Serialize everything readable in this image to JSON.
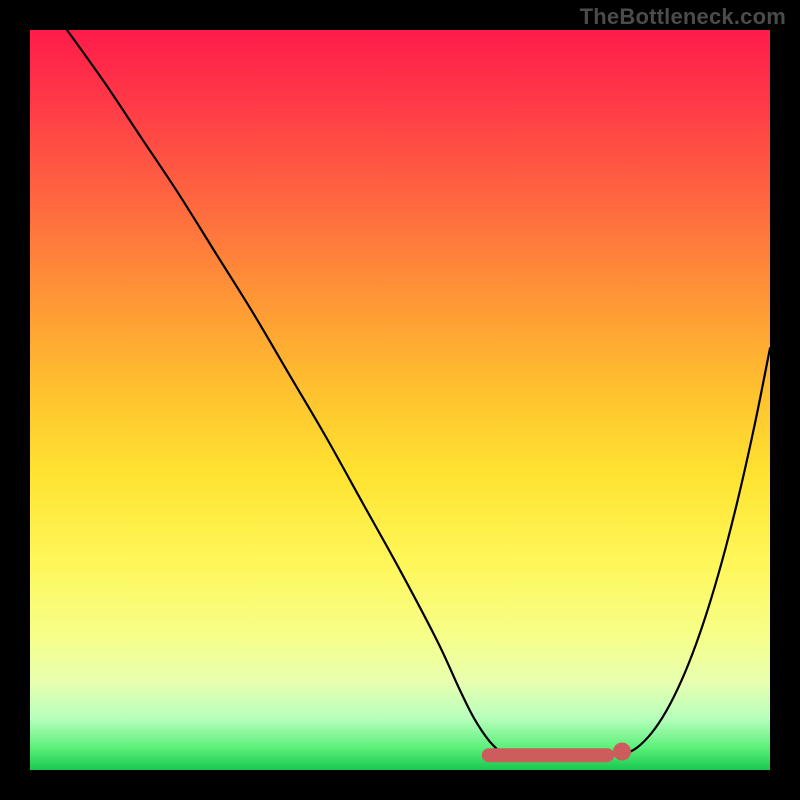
{
  "watermark": "TheBottleneck.com",
  "colors": {
    "background": "#000000",
    "gradient_top": "#ff1c4a",
    "gradient_bottom": "#18c84e",
    "curve": "#000000",
    "accent": "#cd5c5c"
  },
  "chart_data": {
    "type": "line",
    "title": "",
    "xlabel": "",
    "ylabel": "",
    "xlim": [
      0,
      100
    ],
    "ylim": [
      0,
      100
    ],
    "grid": false,
    "legend": false,
    "series": [
      {
        "name": "left-curve",
        "x": [
          5,
          10,
          15,
          20,
          25,
          30,
          35,
          40,
          45,
          50,
          55,
          58,
          60,
          62,
          64
        ],
        "y": [
          100,
          93,
          85.5,
          78,
          70,
          62,
          53.5,
          45,
          36,
          27,
          17.5,
          11,
          7,
          4,
          2
        ]
      },
      {
        "name": "right-curve",
        "x": [
          80,
          82,
          84,
          86,
          88,
          90,
          92,
          94,
          96,
          98,
          100
        ],
        "y": [
          2,
          3,
          5,
          8,
          12,
          17,
          23,
          30,
          38,
          47,
          57
        ]
      }
    ],
    "flat_valley": {
      "x_start": 64,
      "x_end": 80,
      "y": 2
    },
    "accent_segment": {
      "x_start": 62,
      "x_end": 78,
      "y": 2,
      "dot_x": 80,
      "dot_y": 2.5
    }
  }
}
